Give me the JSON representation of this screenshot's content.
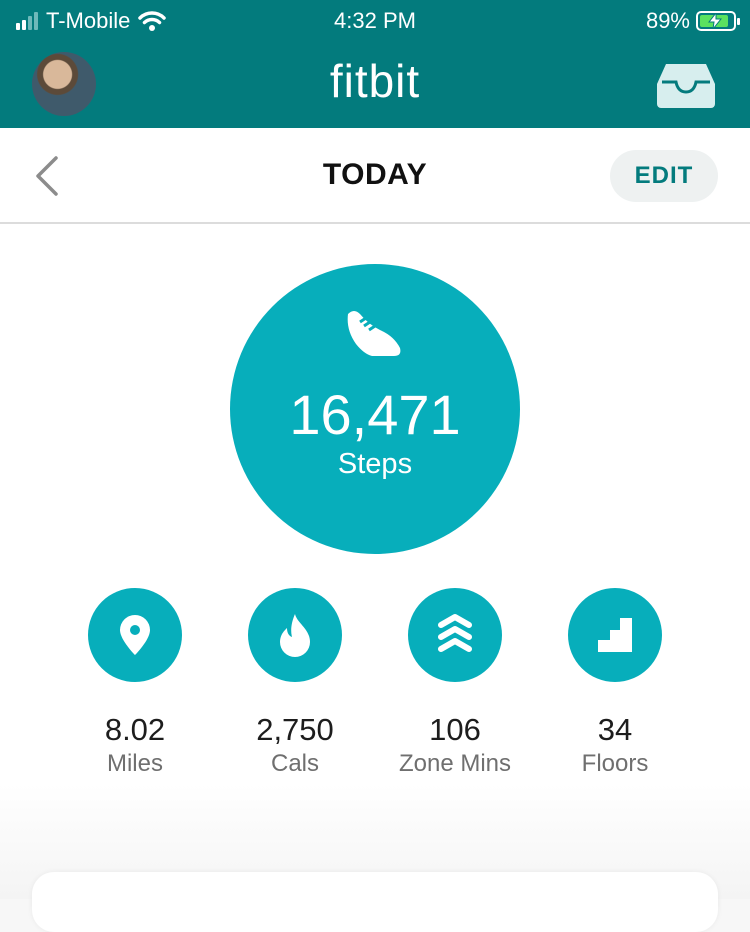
{
  "status_bar": {
    "carrier": "T-Mobile",
    "time": "4:32 PM",
    "battery_percent": "89%",
    "battery_level": 0.89,
    "signal_bars": 2,
    "signal_total": 4
  },
  "header": {
    "logo": "fitbit",
    "avatar_icon": "user-avatar",
    "inbox_icon": "inbox-tray-icon"
  },
  "subheader": {
    "title": "TODAY",
    "edit_label": "EDIT",
    "back_icon": "chevron-left-icon"
  },
  "steps": {
    "value": "16,471",
    "label": "Steps",
    "icon": "shoe-icon"
  },
  "stats": [
    {
      "value": "8.02",
      "label": "Miles",
      "icon": "location-pin-icon"
    },
    {
      "value": "2,750",
      "label": "Cals",
      "icon": "flame-icon"
    },
    {
      "value": "106",
      "label": "Zone Mins",
      "icon": "chevrons-up-icon"
    },
    {
      "value": "34",
      "label": "Floors",
      "icon": "stairs-icon"
    }
  ],
  "colors": {
    "brand_teal": "#037b7d",
    "circle_teal": "#07aebb",
    "battery_green": "#5be25f"
  }
}
